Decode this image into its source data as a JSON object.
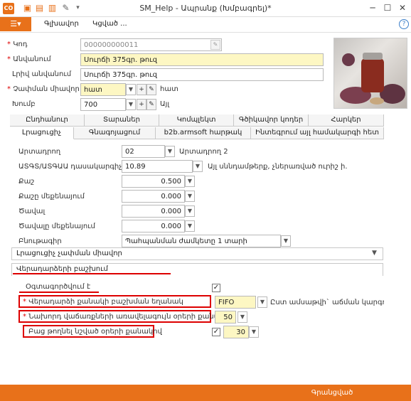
{
  "window": {
    "title": "SM_Help - Ապրանք (Խմբագրել)*",
    "logo": "CO"
  },
  "menu": {
    "main_icon": "menu-icon",
    "items": [
      "Գլխավոր",
      "Կցված ..."
    ]
  },
  "header": {
    "code_label": "Կոդ",
    "code_value": "000000000011",
    "name_label": "Անվանում",
    "name_value": "Սուրճի 375գր. թուզ",
    "fullname_label": "Լրիվ անվանում",
    "fullname_value": "Սուրճի 375գր. թուզ",
    "unit_label": "Չափման միավոր",
    "unit_value": "հատ",
    "unit_text": "հատ",
    "group_label": "Խումբ",
    "group_value": "700",
    "group_text": "Այլ"
  },
  "tabs_row1": [
    "Ընդհանուր",
    "Տարաներ",
    "Կոմպլեկտ",
    "Գծիկավոր կոդեր",
    "Հարկեր"
  ],
  "tabs_row2": [
    "Լրացուցիչ",
    "Գնագոյացում",
    "b2b.armsoft հարթակ",
    "Ինտեգրում այլ համակարգի հետ"
  ],
  "details": {
    "producer_label": "Արտադրող",
    "producer_value": "02",
    "producer_text": "Արտադրող 2",
    "adgtn_label": "ԱՏԳՏ/ԱՏԳԱԱ դասակարգիչ",
    "adgtn_value": "10.89",
    "adgtn_text": "Այլ սննդամթերք, չներառված ուրիշ ի.",
    "weight_label": "Քաշ",
    "weight_value": "0.500",
    "weight_unit_label": "Քաշը մեքենայում",
    "weight_unit_value": "0.000",
    "volume_label": "Ծավալ",
    "volume_value": "0.000",
    "volume_unit_label": "Ծավալը մեքենայում",
    "volume_unit_value": "0.000",
    "nature_label": "Բնութագիր",
    "nature_value": "Պահպանման ժամկետը 1 տարի"
  },
  "sections": {
    "extra_unit": "Լրացուցիչ չափման միավոր",
    "returns": "Վերադարձերի բաշխում"
  },
  "returns": {
    "used_label": "Օգտագործվում է",
    "used_checked": "✓",
    "method_label": "Վերադարձի քանակի բաշխման եղանակ",
    "method_value": "FIFO",
    "method_text": "Ըստ ամսաթվի` աճման կարգով",
    "days_label": "Նախորդ վաճառքների առավելագույն օրերի քանակ",
    "days_value": "50",
    "skip_label": "Բաց թողնել նշված օրերի քանակով",
    "skip_checked": "✓",
    "skip_value": "30"
  },
  "footer": {
    "save_label": "Գրանցված"
  },
  "colors": {
    "accent": "#e8711a",
    "required": "#dd0000",
    "highlight": "#fdf7c3"
  }
}
